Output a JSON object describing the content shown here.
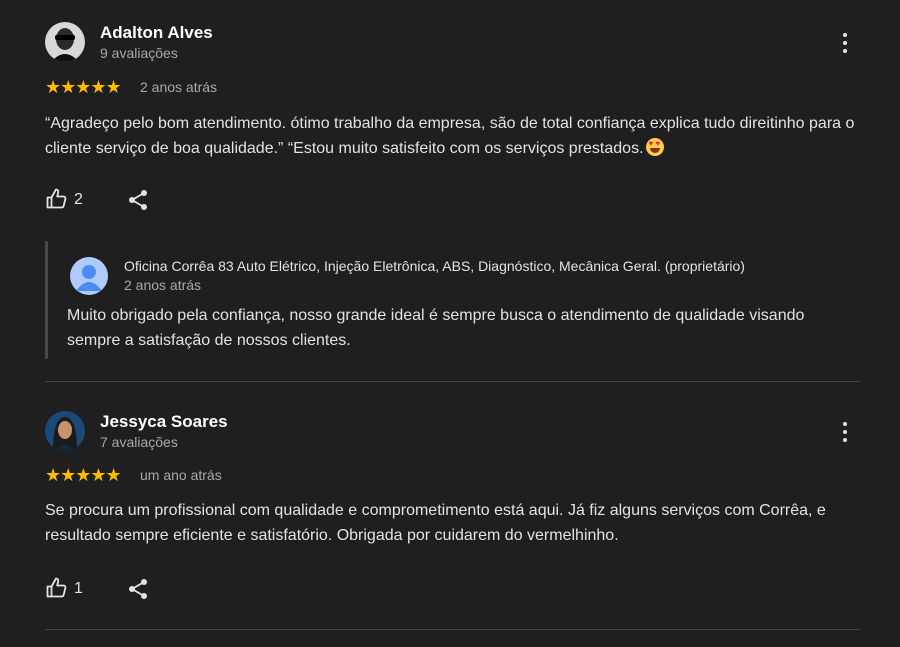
{
  "reviews": [
    {
      "author": "Adalton Alves",
      "review_count": "9 avaliações",
      "stars": "★★★★★",
      "rating": 5,
      "date": "2 anos atrás",
      "text": "“Agradeço pelo bom atendimento. ótimo trabalho da empresa, são de total confiança explica tudo direitinho para o cliente serviço de boa qualidade.” “Estou muito satisfeito com os serviços prestados.",
      "emoji": "smiling-face-with-heart-eyes",
      "likes": "2",
      "reply": {
        "owner": "Oficina Corrêa 83 Auto Elétrico, Injeção Eletrônica, ABS, Diagnóstico, Mecânica Geral. (proprietário)",
        "date": "2 anos atrás",
        "text": "Muito obrigado pela confiança, nosso grande ideal é sempre busca o atendimento de qualidade visando sempre a satisfação de nossos clientes."
      }
    },
    {
      "author": "Jessyca Soares",
      "review_count": "7 avaliações",
      "stars": "★★★★★",
      "rating": 5,
      "date": "um ano atrás",
      "text": "Se procura um profissional com qualidade e comprometimento está aqui. Já fiz alguns serviços com Corrêa, e resultado sempre eficiente e satisfatório. Obrigada por cuidarem do vermelhinho.",
      "likes": "1"
    }
  ],
  "icons": {
    "more": "more-vert-icon",
    "like": "thumb-up-icon",
    "share": "share-icon"
  },
  "colors": {
    "background": "#1f1f1f",
    "star": "#fbbc04",
    "secondary_text": "#a8a8a8"
  }
}
